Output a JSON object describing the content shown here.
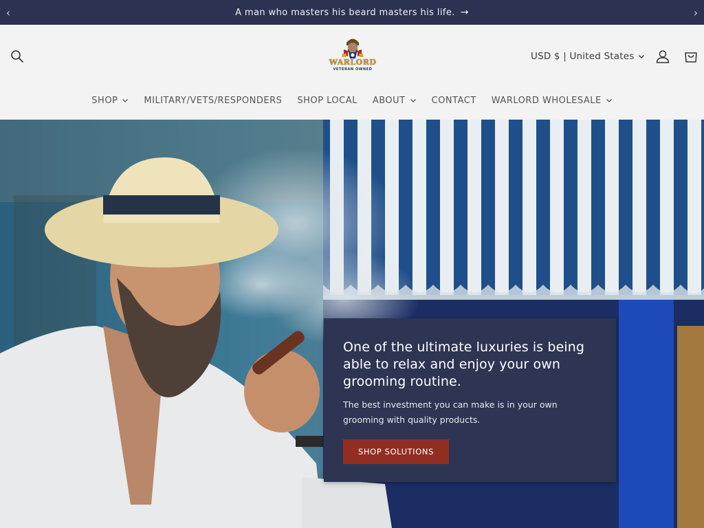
{
  "announcement": {
    "message": "A man who masters his beard masters his life.",
    "link_arrow": "→",
    "prev_arrow": "‹",
    "next_arrow": "›"
  },
  "header": {
    "logo": {
      "wordmark": "WARLORD",
      "tagline": "VETERAN OWNED"
    },
    "currency_selector": "USD $ | United States",
    "icons": {
      "search": "search-icon",
      "account": "user-icon",
      "cart": "cart-icon"
    }
  },
  "nav": {
    "items": [
      {
        "label": "SHOP",
        "has_dropdown": true
      },
      {
        "label": "MILITARY/VETS/RESPONDERS",
        "has_dropdown": false
      },
      {
        "label": "SHOP LOCAL",
        "has_dropdown": false
      },
      {
        "label": "ABOUT",
        "has_dropdown": true
      },
      {
        "label": "CONTACT",
        "has_dropdown": false
      },
      {
        "label": "WARLORD WHOLESALE",
        "has_dropdown": true
      }
    ]
  },
  "hero": {
    "headline": "One of the ultimate luxuries is being able to relax and enjoy your own grooming routine.",
    "subtext": "The best investment you can make is in your own grooming with quality products.",
    "cta_label": "SHOP SOLUTIONS"
  },
  "colors": {
    "announcement_bg": "#2b3252",
    "promo_bg": "#2d3553",
    "cta_bg": "#922d22",
    "header_bg": "#f3f3f3"
  }
}
